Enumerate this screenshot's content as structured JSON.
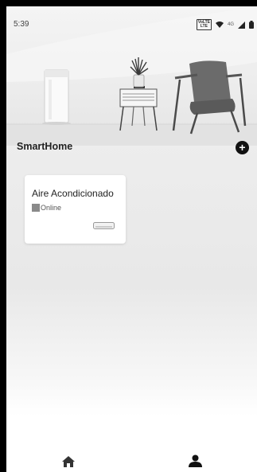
{
  "status_bar": {
    "time": "5:39",
    "volte_line1": "VoLTE",
    "volte_line2": "LTE",
    "network": "4G",
    "icons": [
      "wifi-icon",
      "signal-icon",
      "battery-icon"
    ]
  },
  "home": {
    "title": "SmartHome",
    "add_icon": "+"
  },
  "devices": [
    {
      "name": "Aire Acondicionado",
      "status": "Online",
      "icon": "air-conditioner-icon"
    }
  ],
  "bottom_nav": {
    "items": [
      {
        "icon": "home-icon"
      },
      {
        "icon": "user-icon"
      }
    ]
  },
  "colors": {
    "background": "#ececec",
    "card": "#ffffff",
    "accent": "#111111",
    "status_square": "#8a8a8a"
  }
}
